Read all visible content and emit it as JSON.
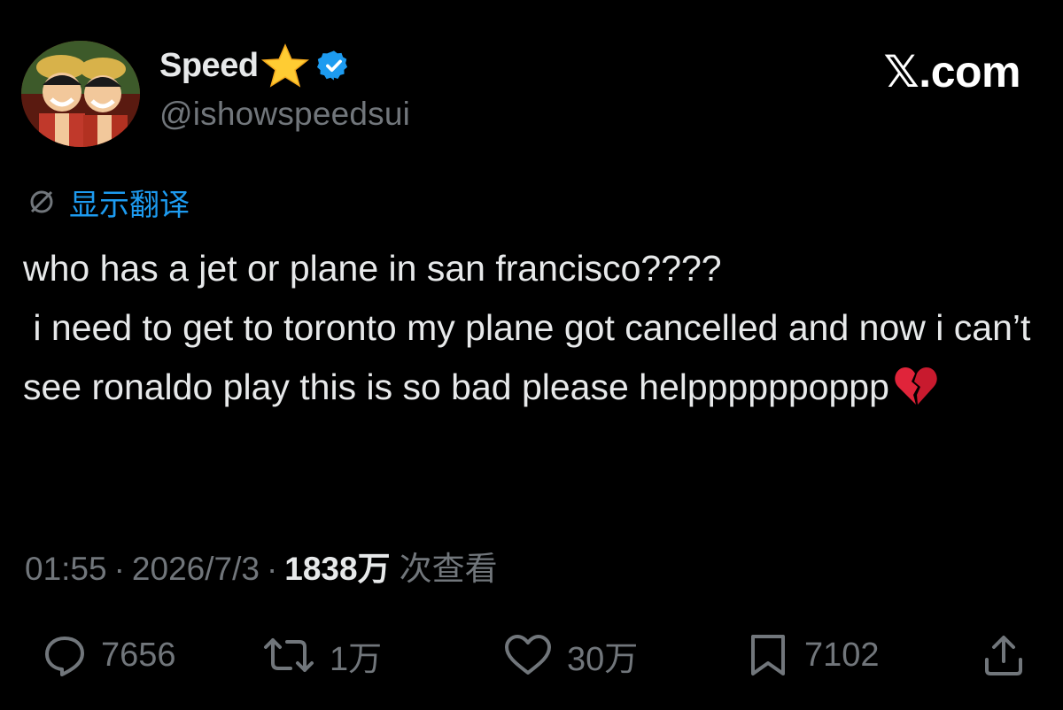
{
  "user": {
    "display_name": "Speed",
    "handle": "@ishowspeedsui",
    "verified": true,
    "name_emoji": "star"
  },
  "brand": "𝕏.com",
  "translate": {
    "label": "显示翻译"
  },
  "tweet": {
    "text": "who has a jet or plane in san francisco????\n i need to get to toronto my plane got cancelled and now i can’t see ronaldo play this is so bad please helppppppoppp",
    "emoji": "broken-heart"
  },
  "meta": {
    "time": "01:55",
    "separator": "·",
    "date": "2026/7/3",
    "views_count": "1838万",
    "views_label": "次查看"
  },
  "actions": {
    "replies": "7656",
    "reposts": "1万",
    "likes": "30万",
    "bookmarks": "7102"
  },
  "colors": {
    "background": "#000000",
    "text": "#e7e9ea",
    "secondary": "#71767b",
    "accent": "#1d9bf0"
  }
}
